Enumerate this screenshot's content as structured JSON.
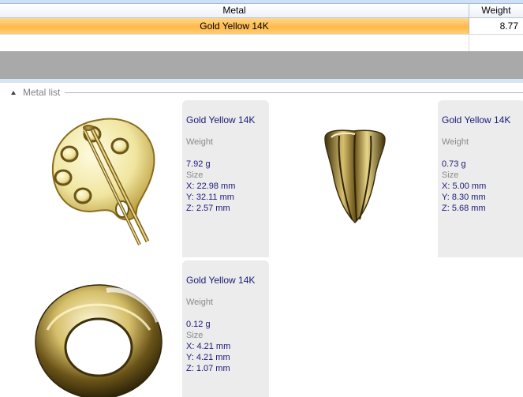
{
  "grid": {
    "headers": {
      "metal": "Metal",
      "weight": "Weight"
    },
    "rows": [
      {
        "metal": "Gold Yellow 14K",
        "weight": "8.77"
      }
    ]
  },
  "metal_list": {
    "title": "Metal list",
    "labels": {
      "weight": "Weight",
      "size": "Size"
    },
    "items": [
      {
        "icon": "palette-pendant-icon",
        "metal": "Gold Yellow 14K",
        "weight": "7.92 g",
        "x": "X: 22.98 mm",
        "y": "Y: 32.11 mm",
        "z": "Z: 2.57 mm"
      },
      {
        "icon": "bail-icon",
        "metal": "Gold Yellow 14K",
        "weight": "0.73 g",
        "x": "X: 5.00 mm",
        "y": "Y: 8.30 mm",
        "z": "Z: 5.68 mm"
      },
      {
        "icon": "jump-ring-icon",
        "metal": "Gold Yellow 14K",
        "weight": "0.12 g",
        "x": "X: 4.21 mm",
        "y": "Y: 4.21 mm",
        "z": "Z: 1.07 mm"
      }
    ]
  },
  "colors": {
    "selection": "#ffb84d",
    "value_text": "#1a1a7a",
    "label_text": "#8a8a8a",
    "card_bg": "#ececec",
    "band": "#a9a9a9"
  }
}
